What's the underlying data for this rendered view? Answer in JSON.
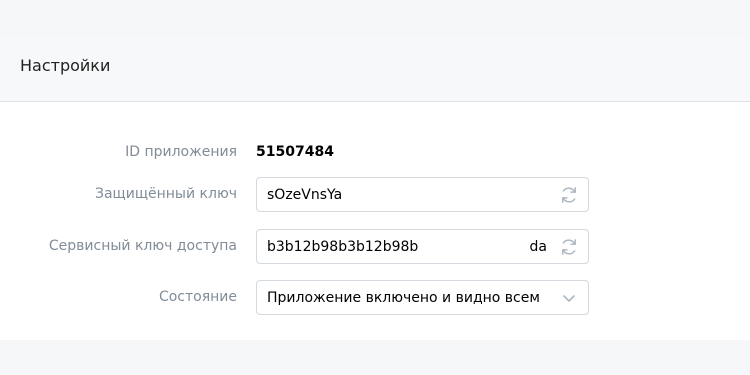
{
  "header": {
    "title": "Настройки"
  },
  "settings": {
    "app_id": {
      "label": "ID приложения",
      "value": "51507484"
    },
    "secure_key": {
      "label": "Защищённый ключ",
      "value": "sOzeVnsYa",
      "refresh_icon": "refresh-icon"
    },
    "service_key": {
      "label": "Сервисный ключ доступа",
      "value": "b3b12b98b3b12b98b",
      "tail": "da",
      "refresh_icon": "refresh-icon"
    },
    "state": {
      "label": "Состояние",
      "value": "Приложение включено и видно всем",
      "dropdown_icon": "chevron-down-icon"
    }
  },
  "colors": {
    "label": "#818c99",
    "border": "#d3d9de",
    "icon": "#aeb7c2"
  }
}
